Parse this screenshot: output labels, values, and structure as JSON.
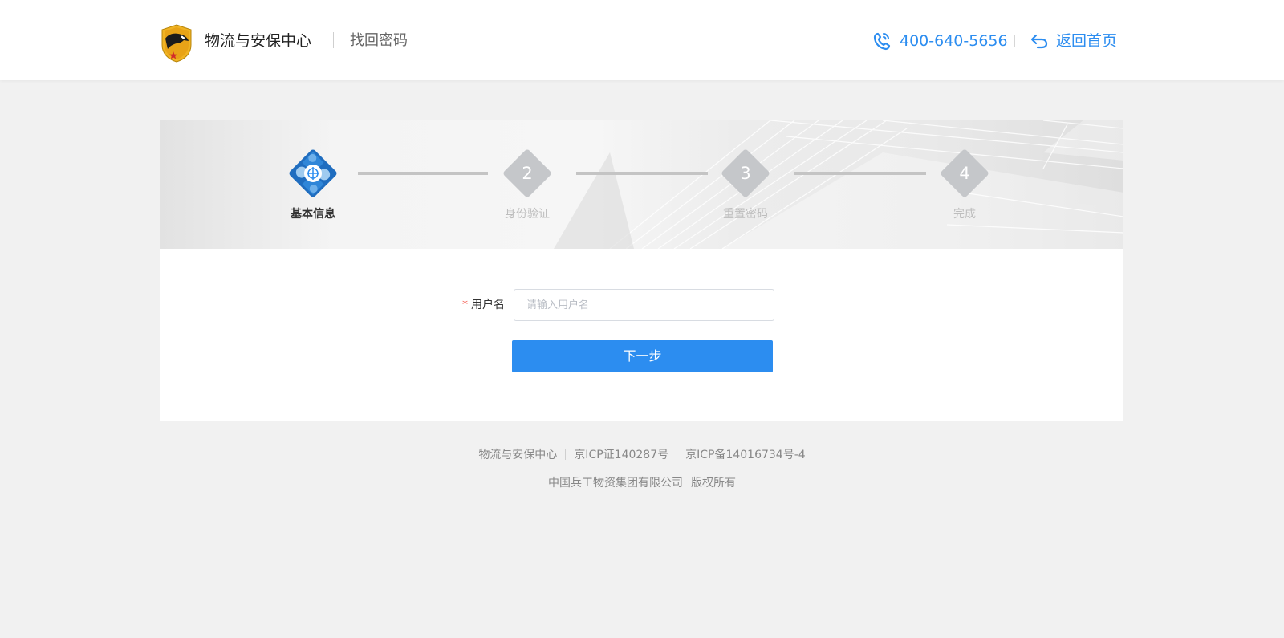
{
  "header": {
    "site_name": "物流与安保中心",
    "page_name": "找回密码",
    "phone": "400-640-5656",
    "back_label": "返回首页"
  },
  "steps": [
    {
      "number": "",
      "label": "基本信息",
      "active": true
    },
    {
      "number": "2",
      "label": "身份验证",
      "active": false
    },
    {
      "number": "3",
      "label": "重置密码",
      "active": false
    },
    {
      "number": "4",
      "label": "完成",
      "active": false
    }
  ],
  "form": {
    "required_mark": "*",
    "username_label": "用户名",
    "username_placeholder": "请输入用户名",
    "username_value": "",
    "next_label": "下一步"
  },
  "footer": {
    "line1": [
      "物流与安保中心",
      "京ICP证140287号",
      "京ICP备14016734号-4"
    ],
    "company": "中国兵工物资集团有限公司",
    "rights": "版权所有"
  },
  "colors": {
    "accent": "#2c8df0",
    "step_inactive": "#c5c7ca",
    "required": "#f5564a"
  }
}
